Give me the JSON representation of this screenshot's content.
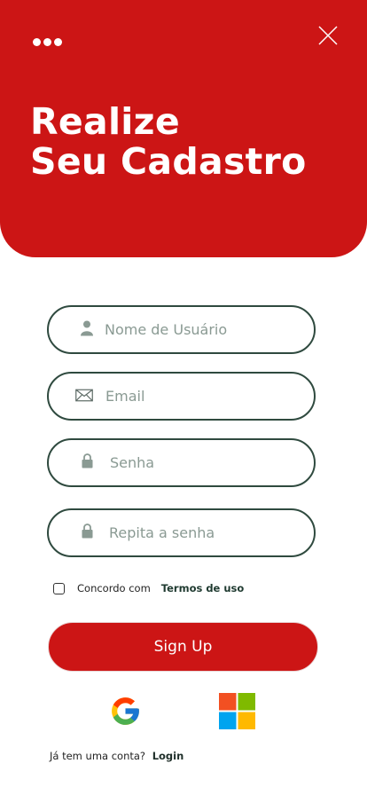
{
  "header": {
    "title_line1": "Realize",
    "title_line2": "Seu Cadastro",
    "menu_icon": "more-dots-icon",
    "close_icon": "close-icon"
  },
  "form": {
    "username": {
      "placeholder": "Nome de Usuário",
      "icon": "user-icon"
    },
    "email": {
      "placeholder": "Email",
      "icon": "mail-icon"
    },
    "password": {
      "placeholder": "Senha",
      "icon": "lock-icon"
    },
    "password_repeat": {
      "placeholder": "Repita a senha",
      "icon": "lock-icon"
    }
  },
  "terms": {
    "text": "Concordo com",
    "link": "Termos de uso",
    "checked": false
  },
  "signup_label": "Sign Up",
  "social": {
    "google_icon": "google-icon",
    "microsoft_icon": "microsoft-icon"
  },
  "footer": {
    "question": "Já tem uma conta?",
    "login_label": "Login"
  },
  "colors": {
    "primary": "#cc1515",
    "border": "#2f4a3f",
    "placeholder": "#8a9a93"
  }
}
